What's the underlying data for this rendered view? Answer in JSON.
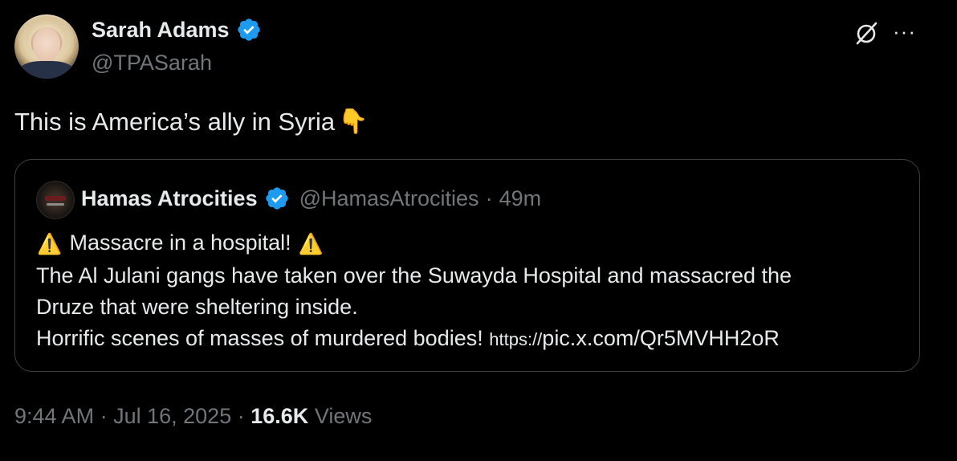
{
  "author": {
    "name": "Sarah Adams",
    "handle": "@TPASarah",
    "verified_color": "#1d9bf0"
  },
  "post": {
    "text": "This is America’s ally in Syria",
    "emoji": "👇"
  },
  "quote": {
    "name": "Hamas Atrocities",
    "handle": "@HamasAtrocities",
    "separator": "·",
    "time": "49m",
    "line1": "Massacre in a hospital!",
    "warning_emoji": "⚠️",
    "line2": "The Al Julani gangs have taken over the Suwayda Hospital and massacred the",
    "line3": "Druze that were sheltering inside.",
    "line4": "Horrific scenes of masses of murdered bodies!",
    "link_scheme": "https://",
    "link_path": "pic.x.com/Qr5MVHH2oR"
  },
  "footer": {
    "time": "9:44 AM",
    "sep1": "·",
    "date": "Jul 16, 2025",
    "sep2": "·",
    "views_count": "16.6K",
    "views_label": "Views"
  },
  "icons": {
    "grok": "grok-icon",
    "more": "more-icon",
    "verified": "verified-badge-icon"
  }
}
